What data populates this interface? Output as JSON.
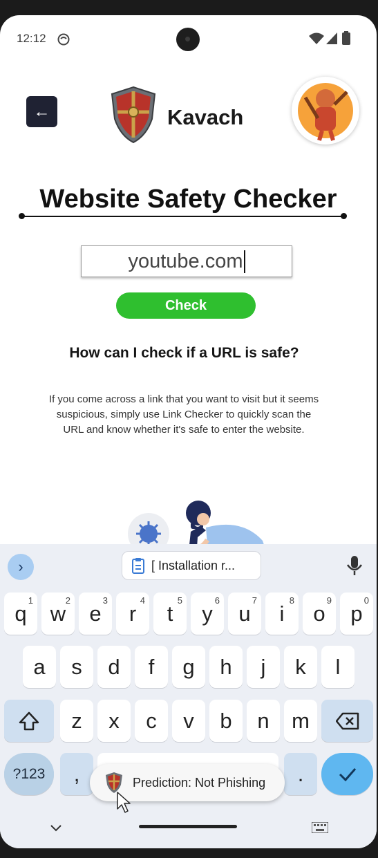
{
  "status_bar": {
    "time": "12:12"
  },
  "header": {
    "app_name": "Kavach",
    "back_label": "←"
  },
  "main": {
    "title": "Website Safety Checker",
    "url_input_value": "youtube.com",
    "check_button": "Check",
    "faq_heading": "How can I check if a URL is safe?",
    "faq_text": "If you come across a link that you want to visit but it seems suspicious, simply use Link Checker to quickly scan the URL and know whether it's safe to enter the website."
  },
  "keyboard": {
    "suggestion_chip": "[ Installation r...",
    "row1": [
      {
        "key": "q",
        "num": "1"
      },
      {
        "key": "w",
        "num": "2"
      },
      {
        "key": "e",
        "num": "3"
      },
      {
        "key": "r",
        "num": "4"
      },
      {
        "key": "t",
        "num": "5"
      },
      {
        "key": "y",
        "num": "6"
      },
      {
        "key": "u",
        "num": "7"
      },
      {
        "key": "i",
        "num": "8"
      },
      {
        "key": "o",
        "num": "9"
      },
      {
        "key": "p",
        "num": "0"
      }
    ],
    "row2": [
      "a",
      "s",
      "d",
      "f",
      "g",
      "h",
      "j",
      "k",
      "l"
    ],
    "row3": [
      "z",
      "x",
      "c",
      "v",
      "b",
      "n",
      "m"
    ],
    "symbols_key": "?123",
    "comma_key": ",",
    "period_key": "."
  },
  "toast": {
    "text": "Prediction: Not Phishing"
  },
  "colors": {
    "accent_green": "#2fbf2f",
    "back_button": "#1f2233",
    "keyboard_enter": "#5fb7f0"
  }
}
